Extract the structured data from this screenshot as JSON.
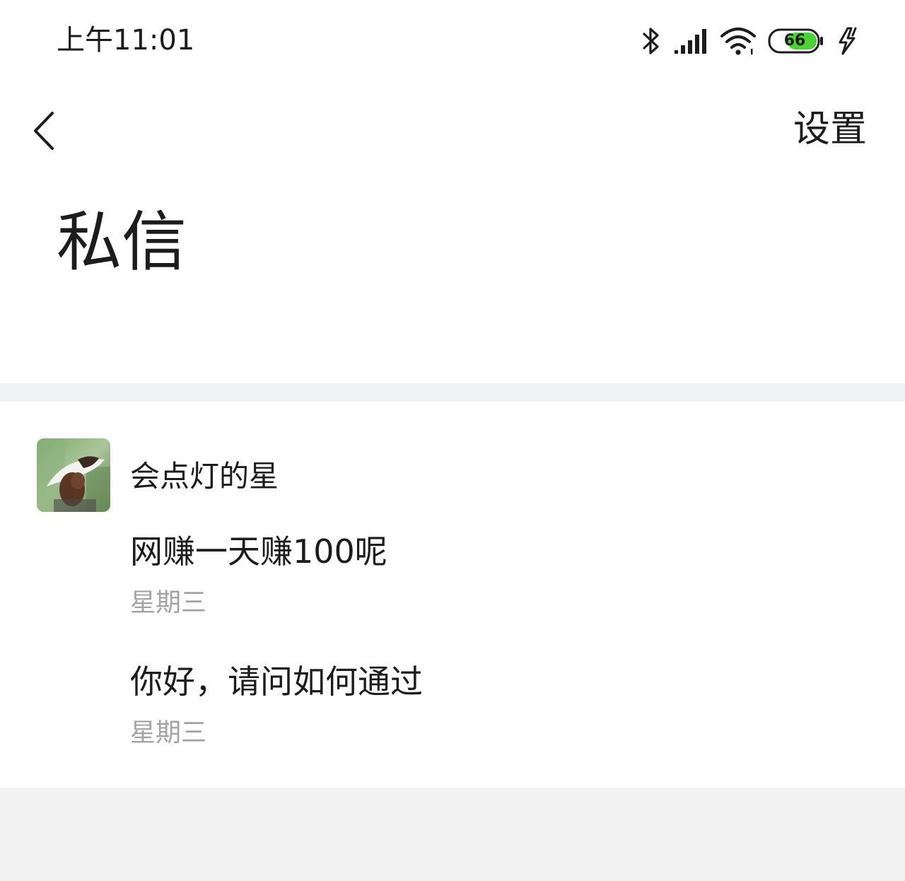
{
  "status_bar": {
    "time": "上午11:01",
    "battery_level": "66",
    "icons": [
      "bluetooth-icon",
      "signal-icon",
      "wifi-icon",
      "battery-icon",
      "charging-icon"
    ],
    "battery_color": "#4cd137"
  },
  "nav": {
    "back_icon": "chevron-left-icon",
    "settings_label": "设置"
  },
  "page": {
    "title": "私信"
  },
  "conversations": [
    {
      "sender": "会点灯的星",
      "messages": [
        {
          "text": "网赚一天赚100呢",
          "time": "星期三"
        },
        {
          "text": "你好，请问如何通过",
          "time": "星期三"
        }
      ]
    }
  ],
  "colors": {
    "background": "#ffffff",
    "divider": "#f0f1f2",
    "text_primary": "#1c1c1c",
    "text_secondary": "#a3a3a3"
  }
}
